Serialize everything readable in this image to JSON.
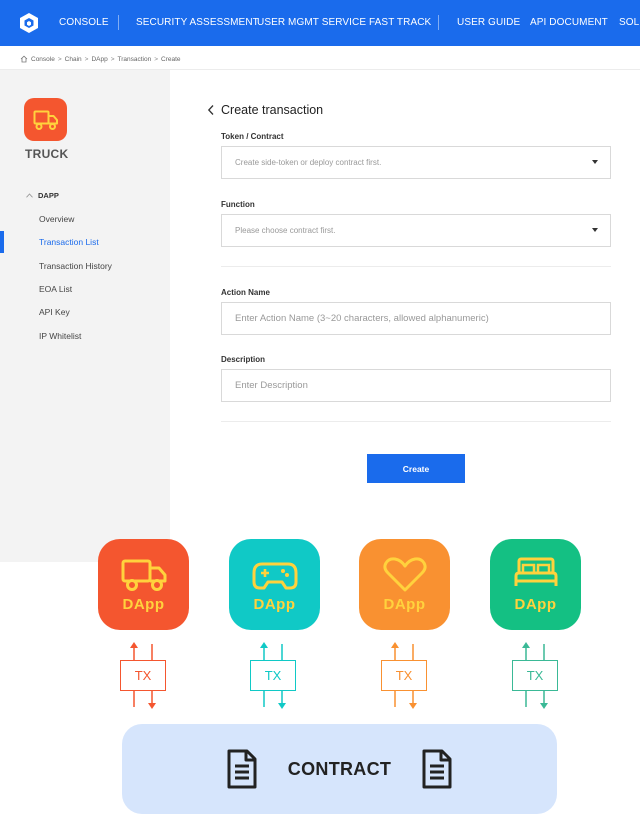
{
  "nav": {
    "items": [
      "CONSOLE",
      "SECURITY ASSESSMENT",
      "USER MGMT SERVICE",
      "FAST TRACK",
      "USER GUIDE",
      "API DOCUMENT",
      "SOLU"
    ]
  },
  "breadcrumb": [
    "Console",
    "Chain",
    "DApp",
    "Transaction",
    "Create"
  ],
  "sidebar": {
    "app_name": "TRUCK",
    "section": "DAPP",
    "items": [
      "Overview",
      "Transaction List",
      "Transaction History",
      "EOA List",
      "API Key",
      "IP Whitelist"
    ],
    "active_index": 1
  },
  "form": {
    "title": "Create transaction",
    "token_label": "Token / Contract",
    "token_placeholder": "Create side-token or deploy contract first.",
    "function_label": "Function",
    "function_placeholder": "Please choose contract first.",
    "action_label": "Action Name",
    "action_placeholder": "Enter Action Name (3~20 characters, allowed alphanumeric)",
    "description_label": "Description",
    "description_placeholder": "Enter Description",
    "create_label": "Create"
  },
  "illustration": {
    "dapps": [
      {
        "label": "DApp",
        "icon": "truck-icon",
        "bg": "#f4562f",
        "fg": "#ffd23d",
        "tx_color": "#f4562f"
      },
      {
        "label": "DApp",
        "icon": "gamepad-icon",
        "bg": "#10c9c6",
        "fg": "#ffd23d",
        "tx_color": "#10c9c6"
      },
      {
        "label": "DApp",
        "icon": "heart-icon",
        "bg": "#f99131",
        "fg": "#ffd23d",
        "tx_color": "#f99131"
      },
      {
        "label": "DApp",
        "icon": "bed-icon",
        "bg": "#14c083",
        "fg": "#ffd23d",
        "tx_color": "#3ab996"
      }
    ],
    "tx_label": "TX",
    "contract_label": "CONTRACT"
  },
  "colors": {
    "brand": "#1a6bec",
    "sidebar_bg": "#f3f3f3",
    "contract_bg": "#d6e5fc"
  }
}
